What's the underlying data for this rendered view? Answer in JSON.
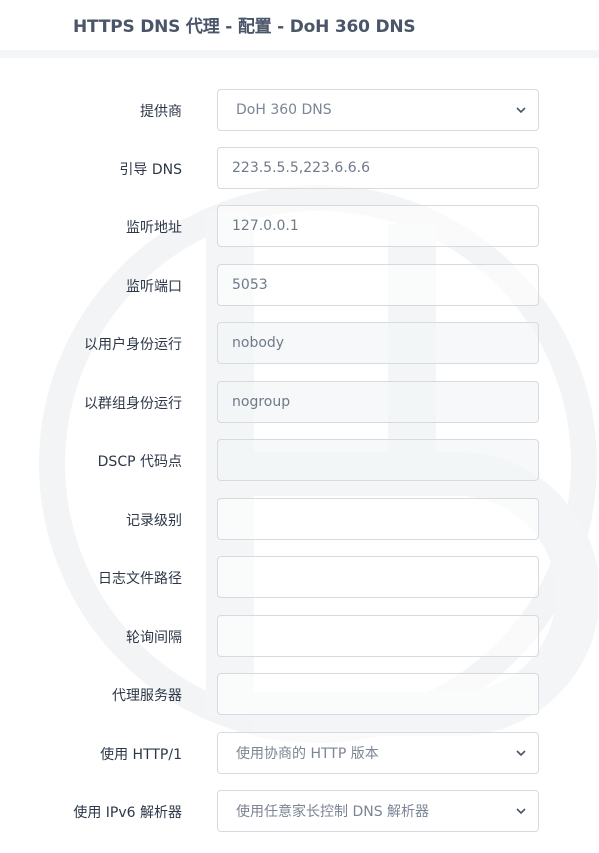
{
  "header": {
    "title": "HTTPS DNS 代理 - 配置 - DoH 360 DNS"
  },
  "form": {
    "provider": {
      "label": "提供商",
      "value": "DoH 360 DNS"
    },
    "bootstrap_dns": {
      "label": "引导 DNS",
      "value": "223.5.5.5,223.6.6.6"
    },
    "listen_addr": {
      "label": "监听地址",
      "value": "127.0.0.1"
    },
    "listen_port": {
      "label": "监听端口",
      "value": "5053"
    },
    "run_as_user": {
      "label": "以用户身份运行",
      "value": "nobody"
    },
    "run_as_group": {
      "label": "以群组身份运行",
      "value": "nogroup"
    },
    "dscp": {
      "label": "DSCP 代码点",
      "value": ""
    },
    "log_level": {
      "label": "记录级别",
      "value": ""
    },
    "log_file": {
      "label": "日志文件路径",
      "value": ""
    },
    "polling_interval": {
      "label": "轮询间隔",
      "value": ""
    },
    "proxy_server": {
      "label": "代理服务器",
      "value": ""
    },
    "use_http1": {
      "label": "使用 HTTP/1",
      "value": "使用协商的 HTTP 版本"
    },
    "use_ipv6": {
      "label": "使用 IPv6 解析器",
      "value": "使用任意家长控制 DNS 解析器"
    }
  },
  "icons": {
    "dropdown": "chevron-down-icon",
    "watermark": "logo-watermark"
  },
  "colors": {
    "background": "#f3f5f8",
    "card": "#ffffff",
    "title": "#4a5568",
    "label": "#2d3748",
    "field_text": "#6f7a89",
    "border": "#d6dbe2"
  }
}
